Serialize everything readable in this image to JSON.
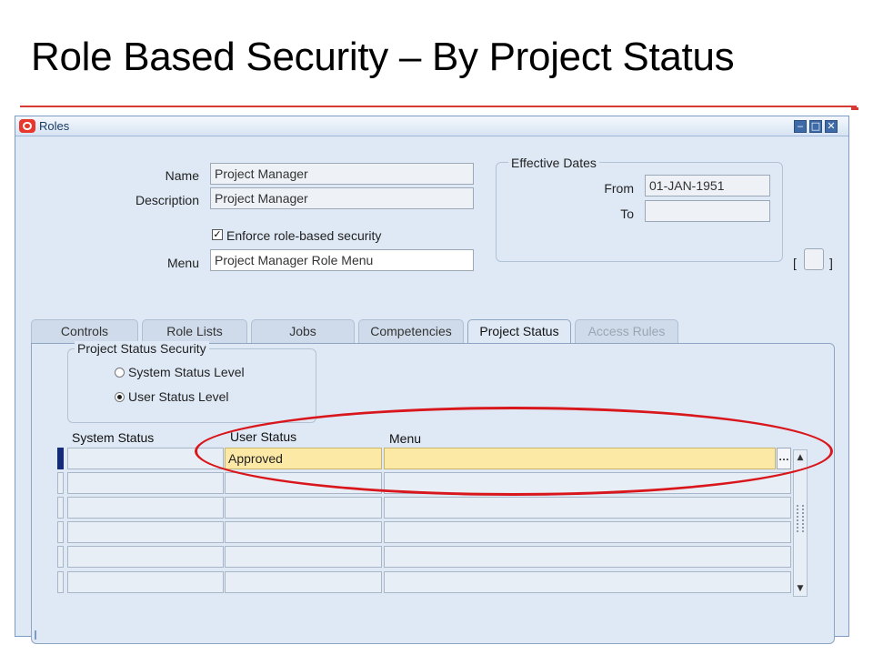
{
  "slide": {
    "title": "Role Based Security – By Project Status"
  },
  "window": {
    "title": "Roles",
    "controls": {
      "minimize": "‒",
      "maximize": "□",
      "close": "✕"
    }
  },
  "form": {
    "name_label": "Name",
    "name_value": "Project Manager",
    "description_label": "Description",
    "description_value": "Project Manager",
    "enforce_checkbox_label": "Enforce role-based security",
    "enforce_checked": true,
    "menu_label": "Menu",
    "menu_value": "Project Manager Role Menu"
  },
  "effective_dates": {
    "title": "Effective Dates",
    "from_label": "From",
    "from_value": "01-JAN-1951",
    "to_label": "To",
    "to_value": ""
  },
  "misc": {
    "bracket_open": "[",
    "bracket_close": "]"
  },
  "tabs": [
    {
      "label": "Controls",
      "state": "normal"
    },
    {
      "label": "Role Lists",
      "state": "normal"
    },
    {
      "label": "Jobs",
      "state": "normal"
    },
    {
      "label": "Competencies",
      "state": "normal"
    },
    {
      "label": "Project Status",
      "state": "active"
    },
    {
      "label": "Access Rules",
      "state": "disabled"
    }
  ],
  "project_status_security": {
    "title": "Project Status Security",
    "options": [
      {
        "label": "System Status Level",
        "selected": false
      },
      {
        "label": "User Status Level",
        "selected": true
      }
    ]
  },
  "grid": {
    "columns": [
      "System Status",
      "User Status",
      "Menu"
    ],
    "rows": [
      {
        "system_status": "",
        "user_status": "Approved",
        "menu": ""
      },
      {
        "system_status": "",
        "user_status": "",
        "menu": ""
      },
      {
        "system_status": "",
        "user_status": "",
        "menu": ""
      },
      {
        "system_status": "",
        "user_status": "",
        "menu": ""
      },
      {
        "system_status": "",
        "user_status": "",
        "menu": ""
      },
      {
        "system_status": "",
        "user_status": "",
        "menu": ""
      }
    ],
    "lov_button": "…"
  },
  "colors": {
    "title_rule": "#d53a35",
    "highlight_ellipse": "#d8161b",
    "current_row_field": "#fde9a6"
  }
}
